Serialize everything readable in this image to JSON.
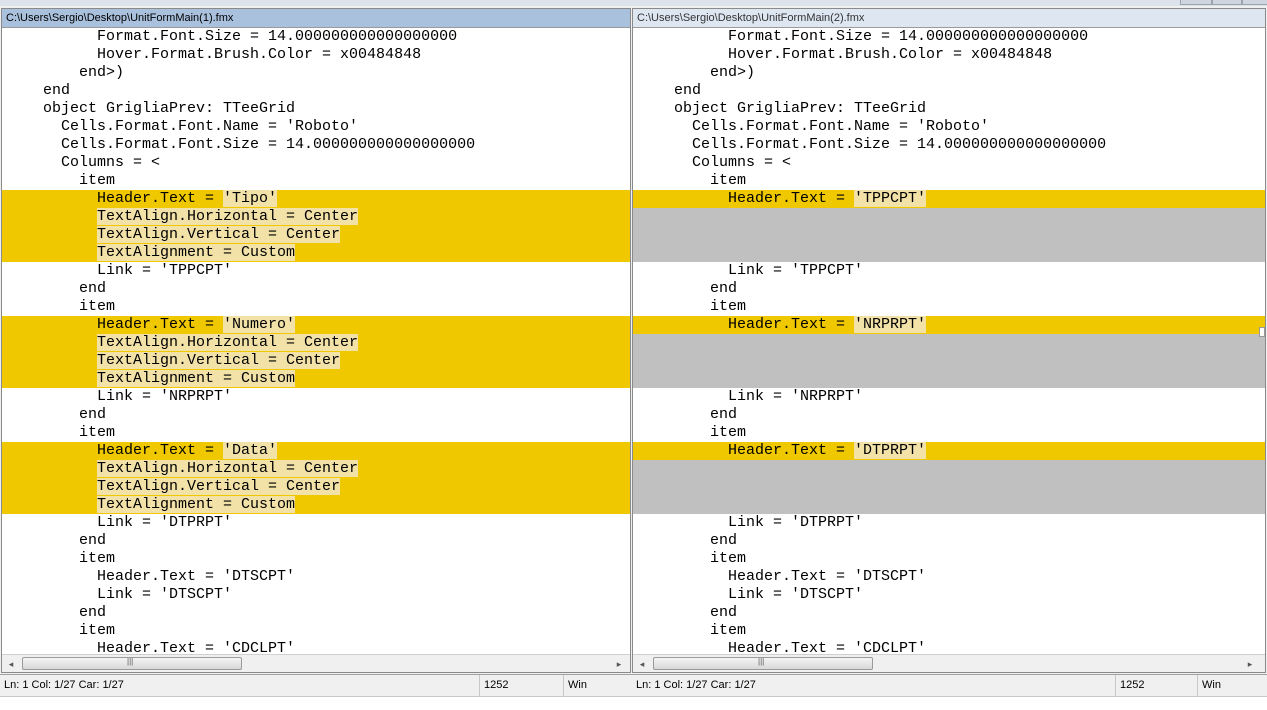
{
  "left": {
    "title": "C:\\Users\\Sergio\\Desktop\\UnitFormMain(1).fmx",
    "lines": [
      {
        "t": "          Format.Font.Size = 14.000000000000000000",
        "k": "n"
      },
      {
        "t": "          Hover.Format.Brush.Color = x00484848",
        "k": "n"
      },
      {
        "t": "        end>)",
        "k": "n"
      },
      {
        "t": "    end",
        "k": "n"
      },
      {
        "t": "    object GrigliaPrev: TTeeGrid",
        "k": "n"
      },
      {
        "t": "      Cells.Format.Font.Name = 'Roboto'",
        "k": "n"
      },
      {
        "t": "      Cells.Format.Font.Size = 14.000000000000000000",
        "k": "n"
      },
      {
        "t": "      Columns = <",
        "k": "n"
      },
      {
        "t": "        item",
        "k": "n"
      },
      {
        "t": "          Header.Text = 'Tipo'",
        "k": "s",
        "pre": "          Header.Text = ",
        "d": "'Tipo'"
      },
      {
        "t": "          TextAlign.Horizontal = Center",
        "k": "l",
        "pre": "          ",
        "d": "TextAlign.Horizontal = Center"
      },
      {
        "t": "          TextAlign.Vertical = Center",
        "k": "l",
        "pre": "          ",
        "d": "TextAlign.Vertical = Center"
      },
      {
        "t": "          TextAlignment = Custom",
        "k": "l",
        "pre": "          ",
        "d": "TextAlignment = Custom"
      },
      {
        "t": "          Link = 'TPPCPT'",
        "k": "n"
      },
      {
        "t": "        end",
        "k": "n"
      },
      {
        "t": "        item",
        "k": "n"
      },
      {
        "t": "          Header.Text = 'Numero'",
        "k": "s",
        "pre": "          Header.Text = ",
        "d": "'Numero'"
      },
      {
        "t": "          TextAlign.Horizontal = Center",
        "k": "l",
        "pre": "          ",
        "d": "TextAlign.Horizontal = Center"
      },
      {
        "t": "          TextAlign.Vertical = Center",
        "k": "l",
        "pre": "          ",
        "d": "TextAlign.Vertical = Center"
      },
      {
        "t": "          TextAlignment = Custom",
        "k": "l",
        "pre": "          ",
        "d": "TextAlignment = Custom"
      },
      {
        "t": "          Link = 'NRPRPT'",
        "k": "n"
      },
      {
        "t": "        end",
        "k": "n"
      },
      {
        "t": "        item",
        "k": "n"
      },
      {
        "t": "          Header.Text = 'Data'",
        "k": "s",
        "pre": "          Header.Text = ",
        "d": "'Data'"
      },
      {
        "t": "          TextAlign.Horizontal = Center",
        "k": "l",
        "pre": "          ",
        "d": "TextAlign.Horizontal = Center"
      },
      {
        "t": "          TextAlign.Vertical = Center",
        "k": "l",
        "pre": "          ",
        "d": "TextAlign.Vertical = Center"
      },
      {
        "t": "          TextAlignment = Custom",
        "k": "l",
        "pre": "          ",
        "d": "TextAlignment = Custom"
      },
      {
        "t": "          Link = 'DTPRPT'",
        "k": "n"
      },
      {
        "t": "        end",
        "k": "n"
      },
      {
        "t": "        item",
        "k": "n"
      },
      {
        "t": "          Header.Text = 'DTSCPT'",
        "k": "n"
      },
      {
        "t": "          Link = 'DTSCPT'",
        "k": "n"
      },
      {
        "t": "        end",
        "k": "n"
      },
      {
        "t": "        item",
        "k": "n"
      },
      {
        "t": "          Header.Text = 'CDCLPT'",
        "k": "n"
      }
    ],
    "status": {
      "pos": "Ln: 1   Col: 1/27   Car: 1/27",
      "size": "1252",
      "eol": "Win"
    }
  },
  "right": {
    "title": "C:\\Users\\Sergio\\Desktop\\UnitFormMain(2).fmx",
    "lines": [
      {
        "t": "          Format.Font.Size = 14.000000000000000000",
        "k": "n"
      },
      {
        "t": "          Hover.Format.Brush.Color = x00484848",
        "k": "n"
      },
      {
        "t": "        end>)",
        "k": "n"
      },
      {
        "t": "    end",
        "k": "n"
      },
      {
        "t": "    object GrigliaPrev: TTeeGrid",
        "k": "n"
      },
      {
        "t": "      Cells.Format.Font.Name = 'Roboto'",
        "k": "n"
      },
      {
        "t": "      Cells.Format.Font.Size = 14.000000000000000000",
        "k": "n"
      },
      {
        "t": "      Columns = <",
        "k": "n"
      },
      {
        "t": "        item",
        "k": "n"
      },
      {
        "t": "          Header.Text = 'TPPCPT'",
        "k": "s",
        "pre": "          Header.Text = ",
        "d": "'TPPCPT'"
      },
      {
        "t": "",
        "k": "g"
      },
      {
        "t": "",
        "k": "g"
      },
      {
        "t": "",
        "k": "g"
      },
      {
        "t": "          Link = 'TPPCPT'",
        "k": "n"
      },
      {
        "t": "        end",
        "k": "n"
      },
      {
        "t": "        item",
        "k": "n"
      },
      {
        "t": "          Header.Text = 'NRPRPT'",
        "k": "s",
        "pre": "          Header.Text = ",
        "d": "'NRPRPT'"
      },
      {
        "t": "",
        "k": "g"
      },
      {
        "t": "",
        "k": "g"
      },
      {
        "t": "",
        "k": "g"
      },
      {
        "t": "          Link = 'NRPRPT'",
        "k": "n"
      },
      {
        "t": "        end",
        "k": "n"
      },
      {
        "t": "        item",
        "k": "n"
      },
      {
        "t": "          Header.Text = 'DTPRPT'",
        "k": "s",
        "pre": "          Header.Text = ",
        "d": "'DTPRPT'"
      },
      {
        "t": "",
        "k": "g"
      },
      {
        "t": "",
        "k": "g"
      },
      {
        "t": "",
        "k": "g"
      },
      {
        "t": "          Link = 'DTPRPT'",
        "k": "n"
      },
      {
        "t": "        end",
        "k": "n"
      },
      {
        "t": "        item",
        "k": "n"
      },
      {
        "t": "          Header.Text = 'DTSCPT'",
        "k": "n"
      },
      {
        "t": "          Link = 'DTSCPT'",
        "k": "n"
      },
      {
        "t": "        end",
        "k": "n"
      },
      {
        "t": "        item",
        "k": "n"
      },
      {
        "t": "          Header.Text = 'CDCLPT'",
        "k": "n"
      }
    ],
    "status": {
      "pos": "Ln: 1   Col: 1/27   Car: 1/27",
      "size": "1252",
      "eol": "Win"
    }
  },
  "scrollbar": {
    "left_arrow": "◂",
    "right_arrow": "▸",
    "grip": "|||"
  },
  "colors": {
    "changed": "#f0c800",
    "changed_text": "#f2e2a8",
    "missing": "#c0c0c0",
    "active_title": "#a9c1dd"
  }
}
